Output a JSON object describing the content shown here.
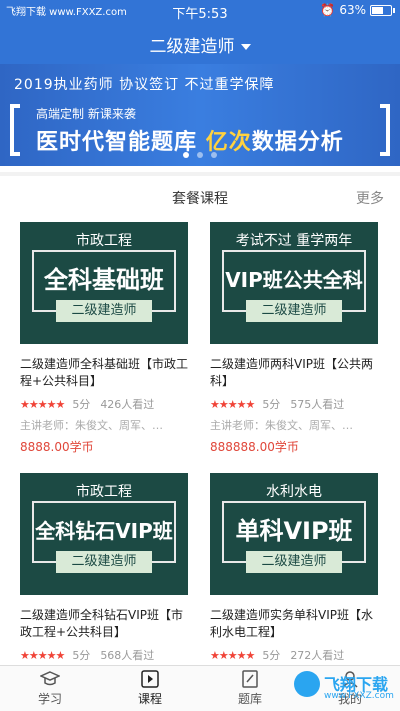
{
  "status_bar": {
    "carrier_text": "飞翔下载 www.FXXZ.com",
    "time": "下午5:53",
    "battery": "63%",
    "battery_level": 0.63
  },
  "header": {
    "title": "二级建造师"
  },
  "banner": {
    "top_text": "2019执业药师   协议签订 不过重学保障",
    "sub_text": "高端定制 新课来袭",
    "main_text": "医时代智能题库",
    "highlight": "亿次",
    "main_tail": "数据分析",
    "slides": 3,
    "active_slide": 0
  },
  "section": {
    "title": "套餐课程",
    "more": "更多"
  },
  "courses": [
    {
      "thumb_top": "市政工程",
      "thumb_main": "全科基础班",
      "thumb_label": "二级建造师",
      "name": "二级建造师全科基础班【市政工程+公共科目】",
      "stars": "★★★★★",
      "rating": "5分",
      "views": "426人看过",
      "teacher": "主讲老师：朱俊文、周军、…",
      "price": "8888.00学币"
    },
    {
      "thumb_top": "考试不过  重学两年",
      "thumb_main": "VIP班公共全科",
      "thumb_label": "二级建造师",
      "name": "二级建造师两科VIP班【公共两科】",
      "stars": "★★★★★",
      "rating": "5分",
      "views": "575人看过",
      "teacher": "主讲老师：朱俊文、周军、…",
      "price": "888888.00学币"
    },
    {
      "thumb_top": "市政工程",
      "thumb_main": "全科钻石VIP班",
      "thumb_label": "二级建造师",
      "name": "二级建造师全科钻石VIP班【市政工程+公共科目】",
      "stars": "★★★★★",
      "rating": "5分",
      "views": "568人看过",
      "teacher": "",
      "price": ""
    },
    {
      "thumb_top": "水利水电",
      "thumb_main": "单科VIP班",
      "thumb_label": "二级建造师",
      "name": "二级建造师实务单科VIP班【水利水电工程】",
      "stars": "★★★★★",
      "rating": "5分",
      "views": "272人看过",
      "teacher": "",
      "price": ""
    }
  ],
  "tabs": [
    {
      "label": "学习",
      "icon": "graduation-cap-icon"
    },
    {
      "label": "课程",
      "icon": "play-icon"
    },
    {
      "label": "题库",
      "icon": "edit-icon"
    },
    {
      "label": "我的",
      "icon": "user-icon"
    }
  ],
  "watermark": {
    "text": "飞翔下载",
    "url": "www.FXXZ.com"
  }
}
